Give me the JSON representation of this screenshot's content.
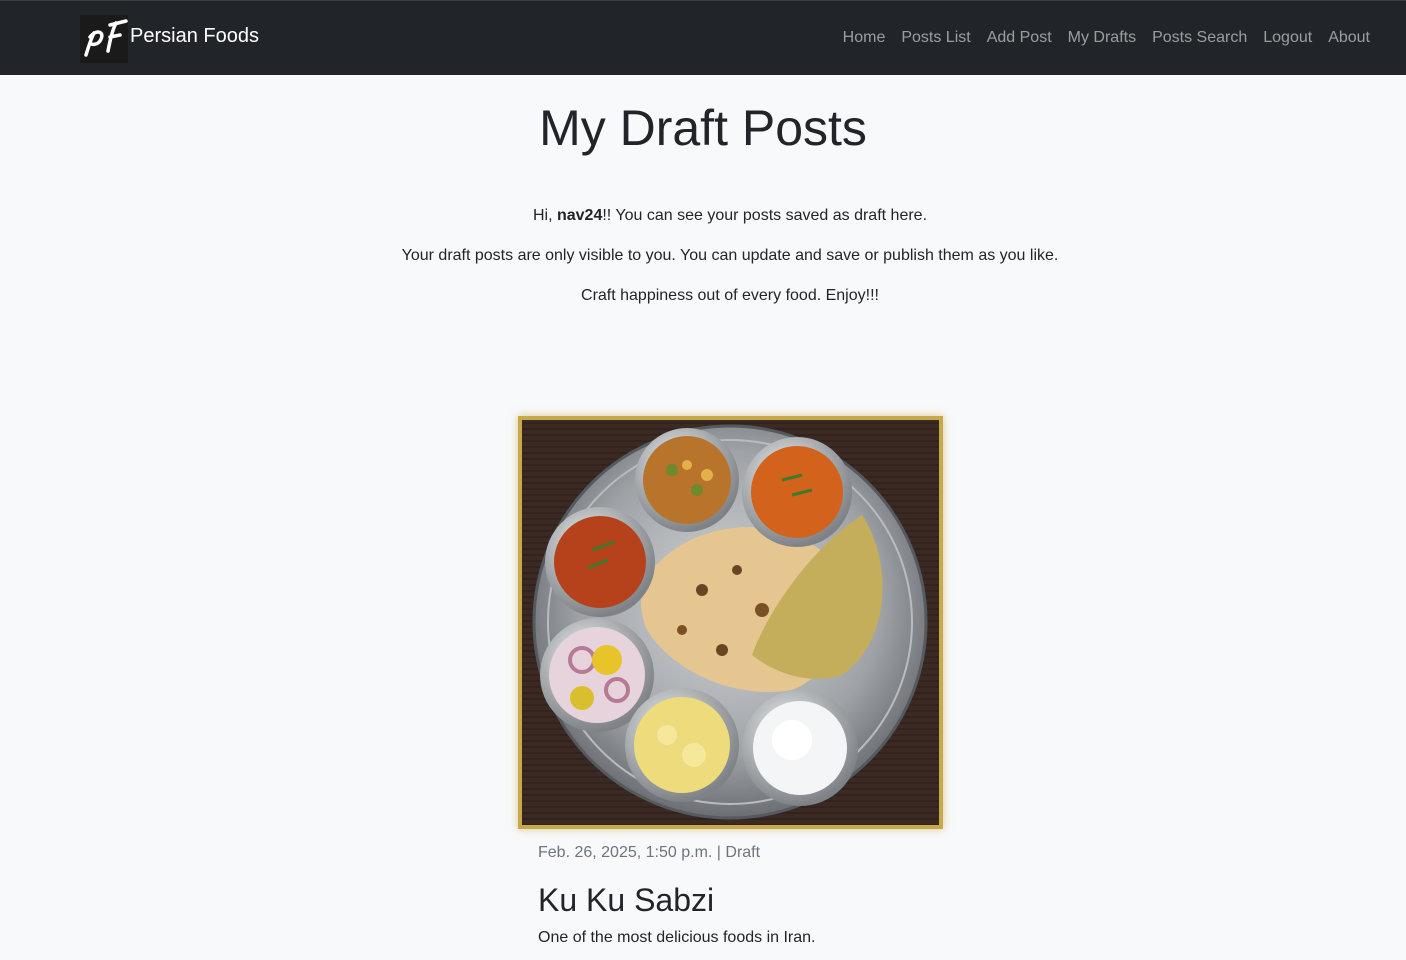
{
  "navbar": {
    "brand_text": "Persian Foods",
    "links": [
      {
        "label": "Home"
      },
      {
        "label": "Posts List"
      },
      {
        "label": "Add Post"
      },
      {
        "label": "My Drafts"
      },
      {
        "label": "Posts Search"
      },
      {
        "label": "Logout"
      },
      {
        "label": "About"
      }
    ]
  },
  "page": {
    "title": "My Draft Posts",
    "greeting_prefix": "Hi, ",
    "username": "nav24",
    "greeting_suffix": "!! You can see your posts saved as draft here.",
    "visibility_note": "Your draft posts are only visible to you. You can update and save or publish them as you like.",
    "motto": "Craft happiness out of every food. Enjoy!!!"
  },
  "post": {
    "meta": "Feb. 26, 2025, 1:50 p.m. | Draft",
    "title": "Ku Ku Sabzi",
    "excerpt": "One of the most delicious foods in Iran."
  },
  "colors": {
    "navbar_bg": "#212529",
    "page_bg": "#f8f9fa",
    "photo_border": "#c8a94a"
  }
}
